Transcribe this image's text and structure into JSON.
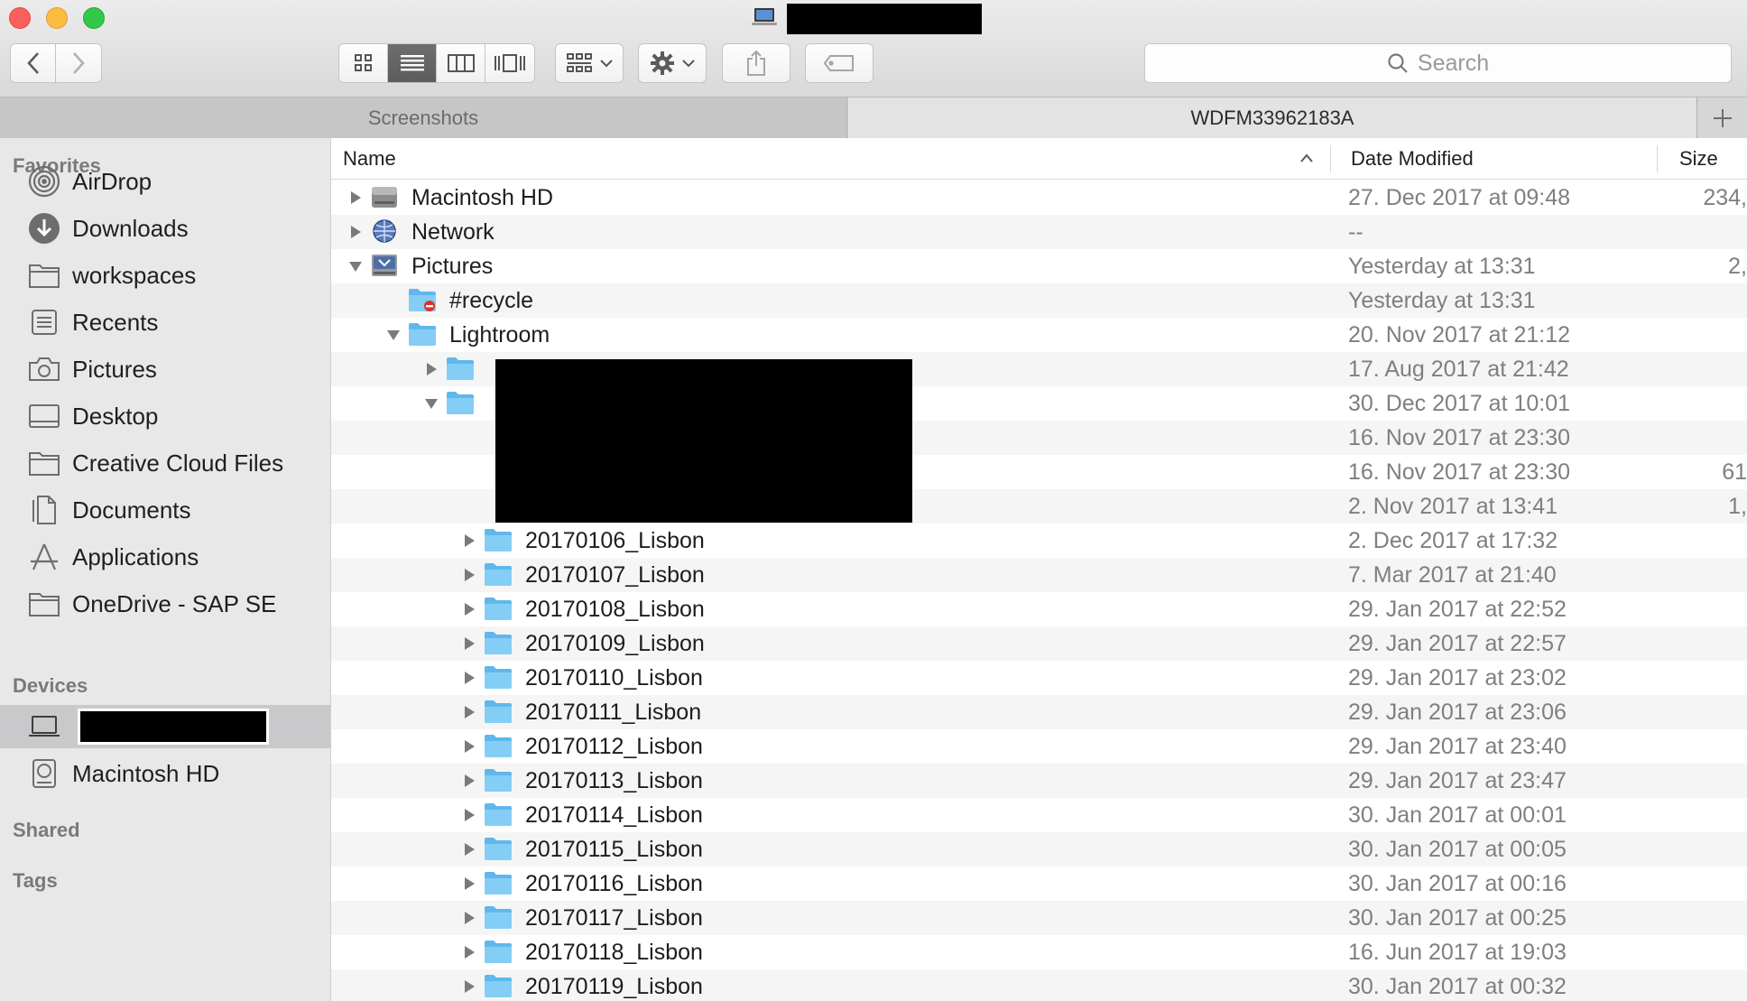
{
  "window": {
    "title_redacted": true
  },
  "toolbar": {
    "search_placeholder": "Search",
    "icons": [
      "back-icon",
      "forward-icon",
      "icon-view-icon",
      "list-view-icon",
      "column-view-icon",
      "coverflow-view-icon",
      "group-icon",
      "gear-icon",
      "share-icon",
      "tag-icon",
      "search-icon"
    ]
  },
  "tabs": [
    {
      "label": "Screenshots",
      "active": false
    },
    {
      "label": "WDFM33962183A",
      "active": true
    }
  ],
  "sidebar": {
    "favorites_label": "Favorites",
    "favorites": [
      {
        "label": "AirDrop",
        "icon": "airdrop-icon"
      },
      {
        "label": "Downloads",
        "icon": "downloads-icon"
      },
      {
        "label": "workspaces",
        "icon": "folder-icon"
      },
      {
        "label": "Recents",
        "icon": "recents-icon"
      },
      {
        "label": "Pictures",
        "icon": "pictures-icon"
      },
      {
        "label": "Desktop",
        "icon": "desktop-icon"
      },
      {
        "label": "Creative Cloud Files",
        "icon": "folder-icon"
      },
      {
        "label": "Documents",
        "icon": "documents-icon"
      },
      {
        "label": "Applications",
        "icon": "applications-icon"
      },
      {
        "label": "OneDrive - SAP SE",
        "icon": "folder-icon"
      }
    ],
    "devices_label": "Devices",
    "devices": [
      {
        "label": "",
        "icon": "laptop-icon",
        "selected": true,
        "redacted": true
      },
      {
        "label": "Macintosh HD",
        "icon": "harddisk-icon",
        "selected": false
      }
    ],
    "shared_label": "Shared",
    "tags_label": "Tags"
  },
  "columns": {
    "name": "Name",
    "date": "Date Modified",
    "size": "Size"
  },
  "rows": [
    {
      "name": "Macintosh HD",
      "date": "27. Dec 2017 at 09:48",
      "size": "234,",
      "level": 0,
      "disc": "collapsed",
      "icon": "harddisk"
    },
    {
      "name": "Network",
      "date": "--",
      "size": "",
      "level": 0,
      "disc": "collapsed",
      "icon": "network"
    },
    {
      "name": "Pictures",
      "date": "Yesterday at 13:31",
      "size": "2,",
      "level": 0,
      "disc": "expanded",
      "icon": "server"
    },
    {
      "name": "#recycle",
      "date": "Yesterday at 13:31",
      "size": "",
      "level": 1,
      "disc": "none",
      "icon": "folder-restricted"
    },
    {
      "name": "Lightroom",
      "date": "20. Nov 2017 at 21:12",
      "size": "",
      "level": 1,
      "disc": "expanded",
      "icon": "folder"
    },
    {
      "name": "",
      "date": "17. Aug 2017 at 21:42",
      "size": "",
      "level": 2,
      "disc": "collapsed",
      "icon": "folder"
    },
    {
      "name": "",
      "date": "30. Dec 2017 at 10:01",
      "size": "",
      "level": 2,
      "disc": "expanded",
      "icon": "folder"
    },
    {
      "name": "",
      "date": "16. Nov 2017 at 23:30",
      "size": "",
      "level": 3,
      "disc": "none",
      "icon": "none"
    },
    {
      "name": "",
      "date": "16. Nov 2017 at 23:30",
      "size": "61",
      "level": 3,
      "disc": "none",
      "icon": "none"
    },
    {
      "name": "",
      "date": "2. Nov 2017 at 13:41",
      "size": "1,",
      "level": 3,
      "disc": "none",
      "icon": "none"
    },
    {
      "name": "20170106_Lisbon",
      "date": "2. Dec 2017 at 17:32",
      "size": "",
      "level": 3,
      "disc": "collapsed",
      "icon": "folder"
    },
    {
      "name": "20170107_Lisbon",
      "date": "7. Mar 2017 at 21:40",
      "size": "",
      "level": 3,
      "disc": "collapsed",
      "icon": "folder"
    },
    {
      "name": "20170108_Lisbon",
      "date": "29. Jan 2017 at 22:52",
      "size": "",
      "level": 3,
      "disc": "collapsed",
      "icon": "folder"
    },
    {
      "name": "20170109_Lisbon",
      "date": "29. Jan 2017 at 22:57",
      "size": "",
      "level": 3,
      "disc": "collapsed",
      "icon": "folder"
    },
    {
      "name": "20170110_Lisbon",
      "date": "29. Jan 2017 at 23:02",
      "size": "",
      "level": 3,
      "disc": "collapsed",
      "icon": "folder"
    },
    {
      "name": "20170111_Lisbon",
      "date": "29. Jan 2017 at 23:06",
      "size": "",
      "level": 3,
      "disc": "collapsed",
      "icon": "folder"
    },
    {
      "name": "20170112_Lisbon",
      "date": "29. Jan 2017 at 23:40",
      "size": "",
      "level": 3,
      "disc": "collapsed",
      "icon": "folder"
    },
    {
      "name": "20170113_Lisbon",
      "date": "29. Jan 2017 at 23:47",
      "size": "",
      "level": 3,
      "disc": "collapsed",
      "icon": "folder"
    },
    {
      "name": "20170114_Lisbon",
      "date": "30. Jan 2017 at 00:01",
      "size": "",
      "level": 3,
      "disc": "collapsed",
      "icon": "folder"
    },
    {
      "name": "20170115_Lisbon",
      "date": "30. Jan 2017 at 00:05",
      "size": "",
      "level": 3,
      "disc": "collapsed",
      "icon": "folder"
    },
    {
      "name": "20170116_Lisbon",
      "date": "30. Jan 2017 at 00:16",
      "size": "",
      "level": 3,
      "disc": "collapsed",
      "icon": "folder"
    },
    {
      "name": "20170117_Lisbon",
      "date": "30. Jan 2017 at 00:25",
      "size": "",
      "level": 3,
      "disc": "collapsed",
      "icon": "folder"
    },
    {
      "name": "20170118_Lisbon",
      "date": "16. Jun 2017 at 19:03",
      "size": "",
      "level": 3,
      "disc": "collapsed",
      "icon": "folder"
    },
    {
      "name": "20170119_Lisbon",
      "date": "30. Jan 2017 at 00:32",
      "size": "",
      "level": 3,
      "disc": "collapsed",
      "icon": "folder"
    }
  ],
  "colors": {
    "folder": "#6cc4f2",
    "selected_sidebar": "#c9c9cc",
    "close": "#fc605c",
    "minimize": "#fdbc40",
    "zoom": "#34c84a"
  }
}
